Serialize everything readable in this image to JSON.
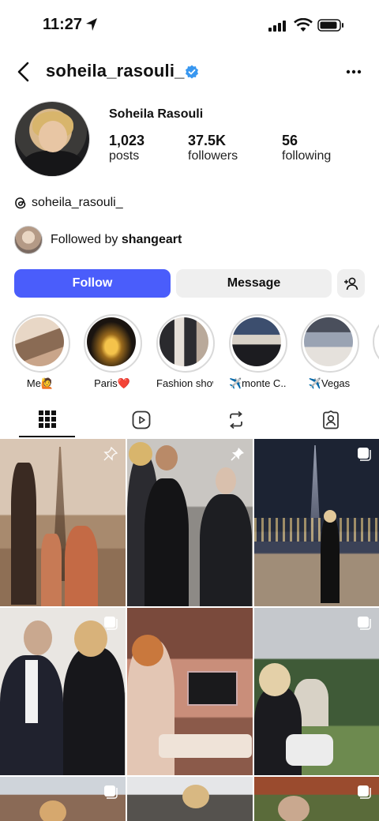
{
  "status_bar": {
    "time": "11:27"
  },
  "header": {
    "username": "soheila_rasouli_"
  },
  "profile": {
    "full_name": "Soheila Rasouli",
    "stats": [
      {
        "value": "1,023",
        "label": "posts"
      },
      {
        "value": "37.5K",
        "label": "followers"
      },
      {
        "value": "56",
        "label": "following"
      }
    ],
    "threads_handle": "soheila_rasouli_",
    "followed_by_prefix": "Followed by",
    "followed_by_user": "shangeart"
  },
  "actions": {
    "follow_label": "Follow",
    "message_label": "Message"
  },
  "highlights": [
    {
      "label": "Me🙋"
    },
    {
      "label": "Paris❤️"
    },
    {
      "label": "Fashion show"
    },
    {
      "label": "✈️monte C..."
    },
    {
      "label": "✈️Vegas"
    }
  ],
  "colors": {
    "accent": "#4a5dfb",
    "verified": "#3897f0"
  },
  "tabs": [
    {
      "icon": "grid-icon",
      "active": true
    },
    {
      "icon": "reels-icon",
      "active": false
    },
    {
      "icon": "reposts-icon",
      "active": false
    },
    {
      "icon": "tagged-icon",
      "active": false
    }
  ]
}
